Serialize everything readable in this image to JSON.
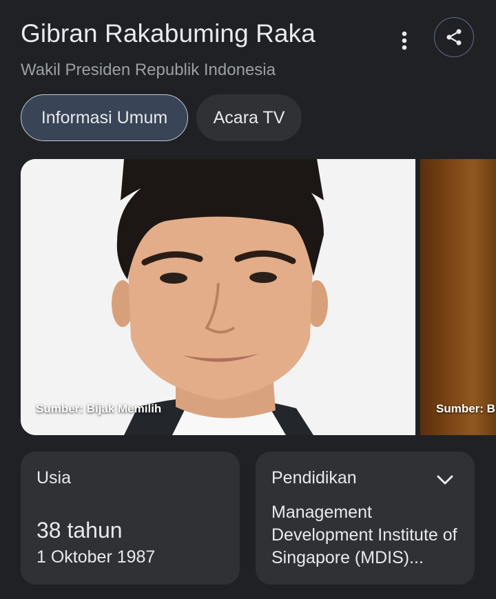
{
  "header": {
    "title": "Gibran Rakabuming Raka",
    "subtitle": "Wakil Presiden Republik Indonesia",
    "more_icon": "more-vert-icon",
    "share_icon": "share-icon"
  },
  "tabs": [
    {
      "label": "Informasi Umum",
      "active": true
    },
    {
      "label": "Acara TV",
      "active": false
    }
  ],
  "images": [
    {
      "caption": "Sumber: Bijak Memilih"
    },
    {
      "caption": "Sumber: B"
    }
  ],
  "cards": {
    "age": {
      "label": "Usia",
      "value": "38 tahun",
      "detail": "1 Oktober 1987"
    },
    "education": {
      "label": "Pendidikan",
      "value": "Management Development Institute of Singapore (MDIS)..."
    }
  },
  "colors": {
    "background": "#202124",
    "card": "#303134",
    "active_chip": "#394457",
    "muted_text": "#9aa0a6"
  }
}
